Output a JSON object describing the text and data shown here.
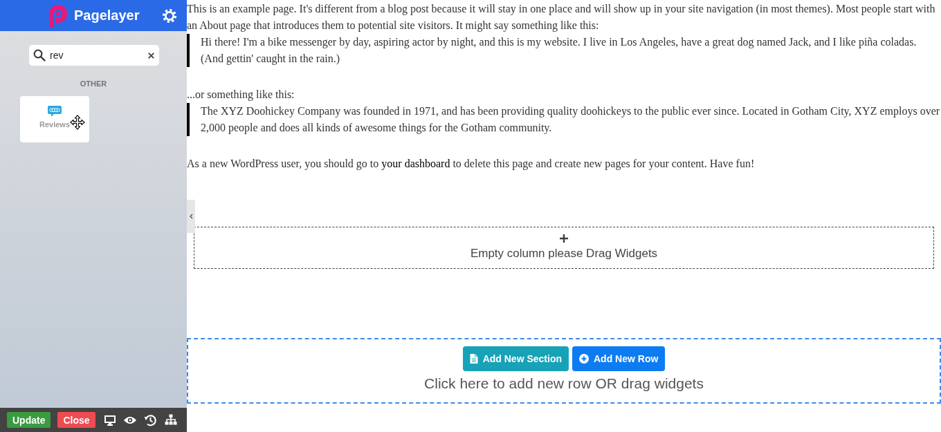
{
  "sidebar": {
    "brand": "Pagelayer",
    "search": {
      "value": "rev"
    },
    "category": "OTHER",
    "widgets": [
      {
        "label": "Reviews"
      }
    ],
    "footer_buttons": [
      {
        "label": "Update",
        "kind": "update"
      },
      {
        "label": "Close",
        "kind": "close"
      }
    ]
  },
  "content": {
    "blocks": [
      {
        "kind": "paragraph",
        "parts": [
          {
            "kind": "text",
            "text": "This is an example page. It's different from a blog post because it will stay in one place and will show up in your site navigation (in most themes). Most people start with an About page that introduces them to potential site visitors. It might say something like this:"
          }
        ]
      },
      {
        "kind": "quote",
        "parts": [
          {
            "kind": "text",
            "text": "Hi there! I'm a bike messenger by day, aspiring actor by night, and this is my website. I live in Los Angeles, have a great dog named Jack, and I like piña coladas. (And gettin' caught in the rain.)"
          }
        ]
      },
      {
        "kind": "paragraph",
        "parts": [
          {
            "kind": "text",
            "text": "...or something like this:"
          }
        ]
      },
      {
        "kind": "quote",
        "parts": [
          {
            "kind": "text",
            "text": "The XYZ Doohickey Company was founded in 1971, and has been providing quality doohickeys to the public ever since. Located in Gotham City, XYZ employs over 2,000 people and does all kinds of awesome things for the Gotham community."
          }
        ]
      },
      {
        "kind": "paragraph",
        "parts": [
          {
            "kind": "text",
            "text": "As a new WordPress user, you should go to "
          },
          {
            "kind": "link",
            "text": "your dashboard"
          },
          {
            "kind": "text",
            "text": " to delete this page and create new pages for your content. Have fun!"
          }
        ]
      }
    ],
    "empty_column": {
      "text": "Empty column please Drag Widgets"
    },
    "add_area": {
      "buttons": [
        {
          "label": "Add New Section",
          "kind": "section"
        },
        {
          "label": "Add New Row",
          "kind": "row"
        }
      ],
      "hint": "Click here to add new row OR drag widgets"
    }
  }
}
